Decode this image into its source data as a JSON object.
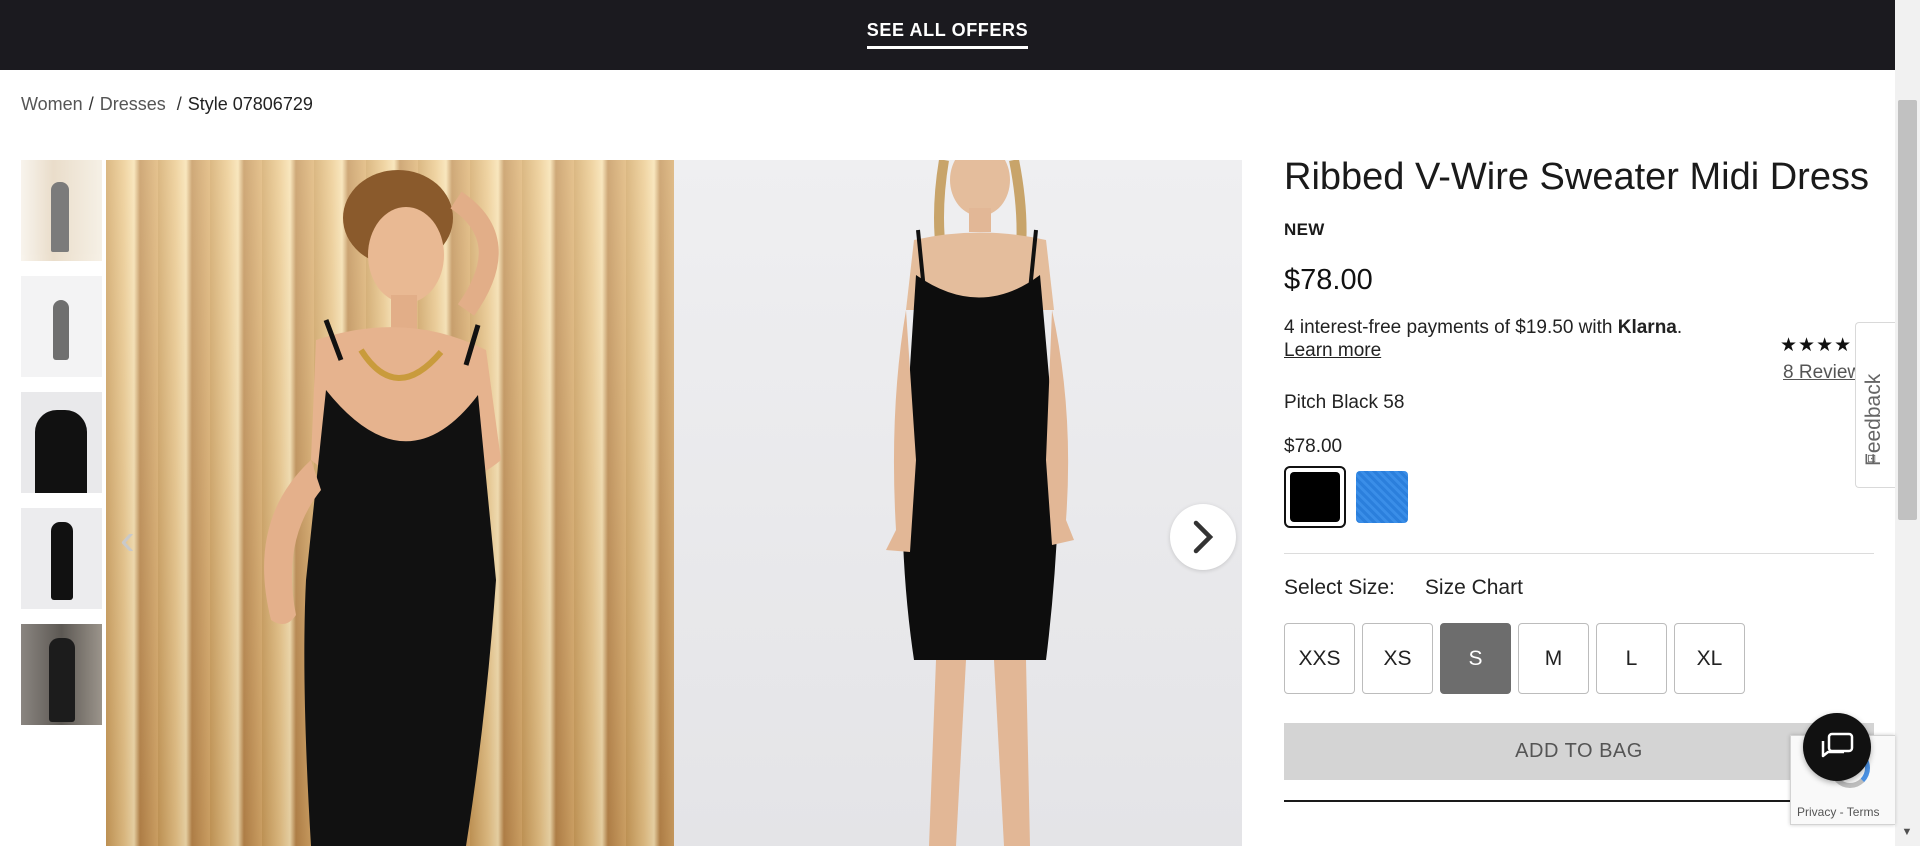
{
  "promo": {
    "label": "SEE ALL OFFERS"
  },
  "breadcrumb": {
    "items": [
      "Women",
      "Dresses"
    ],
    "current": "Style 07806729"
  },
  "product": {
    "title": "Ribbed V-Wire Sweater Midi Dress",
    "badge": "NEW",
    "price": "$78.00",
    "klarna_prefix": "4 interest-free payments of $19.50 with ",
    "klarna_brand": "Klarna",
    "klarna_suffix": ".",
    "learn_more": "Learn more",
    "color_name": "Pitch Black 58",
    "color_price": "$78.00",
    "swatches": [
      {
        "name": "pitch-black",
        "color": "#000000",
        "selected": true
      },
      {
        "name": "blue",
        "color": "#2b7fdc",
        "selected": false
      }
    ],
    "select_size_label": "Select Size:",
    "size_chart_label": "Size Chart",
    "sizes": [
      "XXS",
      "XS",
      "S",
      "M",
      "L",
      "XL"
    ],
    "selected_size": "S",
    "add_to_bag": "ADD TO BAG"
  },
  "rating": {
    "stars": "★★★★",
    "reviews": "8 Reviews"
  },
  "feedback": {
    "label": "Feedback"
  },
  "recaptcha": {
    "links": "Privacy - Terms"
  },
  "colors": {
    "promo_bg": "#1b1a1f",
    "selected_size_bg": "#6d6d6d",
    "add_to_bag_bg": "#d4d4d4"
  }
}
